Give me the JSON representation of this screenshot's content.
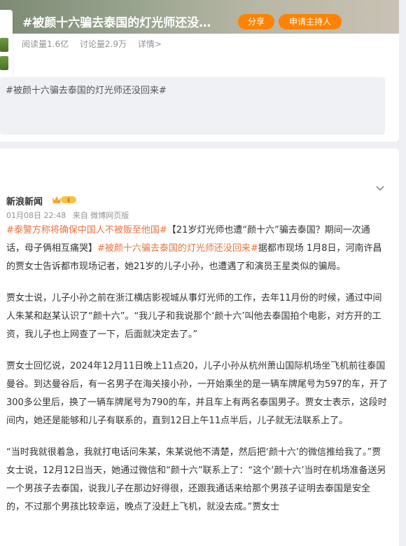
{
  "topic": {
    "title": "#被颜十六骗去泰国的灯光师还没…",
    "share_label": "分享",
    "host_label": "申请主持人",
    "reads": "阅读量1.6亿",
    "discussions": "讨论量2.9万",
    "details": "详情>",
    "quote": "#被颜十六骗去泰国的灯光师还没回来#"
  },
  "post": {
    "author": "新浪新闻",
    "date": "01月08日 22:48",
    "source": "来自 微博网页版",
    "p1_tag1": "#泰警方称将确保中国人不被贩至他国#",
    "p1_text1": "【21岁灯光师也遭“颜十六”骗去泰国？期间一次通话，母子俩相互痛哭】",
    "p1_tag2": "#被颜十六骗去泰国的灯光师还没回来#",
    "p1_text2": "据都市现场 1月8日，河南许昌的贾女士告诉都市现场记者，她21岁的儿子小孙，也遭遇了和演员王星类似的骗局。",
    "p2": "贾女士说，儿子小孙之前在浙江横店影视城从事灯光师的工作，去年11月份的时候，通过中间人朱某和赵某认识了“颜十六”。“我儿子和我说那个‘颜十六’叫他去泰国拍个电影，对方开的工资，我儿子也上网查了一下，后面就决定去了。”",
    "p3": "贾女士回忆说，2024年12月11日晚上11点20，儿子小孙从杭州萧山国际机场坐飞机前往泰国曼谷。到达曼谷后，有一名男子在海关接小孙，一开始乘坐的是一辆车牌尾号为597的车，开了300多公里后，换了一辆车牌尾号为790的车，并且车上有两名泰国男子。贾女士表示，这段时间内，她还是能够和儿子有联系的，直到12日上午11点半后，儿子就无法联系上了。",
    "p4": "“当时我就很着急，我就打电话问朱某，朱某说他不清楚，然后把‘颜十六’的微信推给我了。”贾女士说，12月12日当天，她通过微信和“颜十六”联系上了：“这个‘颜十六’当时在机场准备送另一个男孩子去泰国，说我儿子在那边好得很，还跟我通话来给那个男孩子证明去泰国是安全的，不过那个男孩比较幸运，晚点了没赶上飞机，就没去成。”贾女士"
  },
  "colors": {
    "accent": "#ff8200",
    "tag": "#eb7340"
  }
}
